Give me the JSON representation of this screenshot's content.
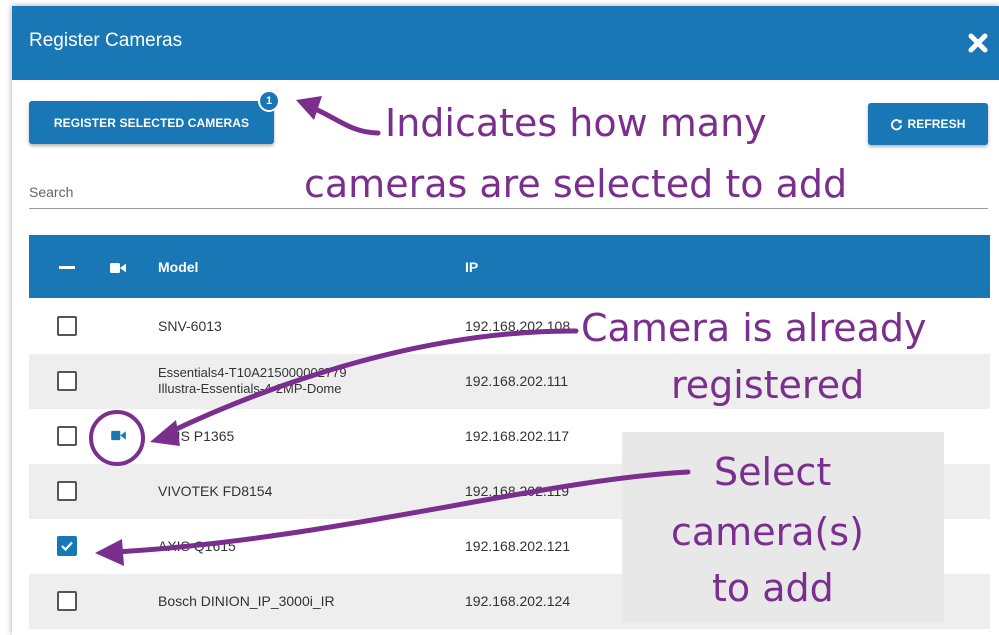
{
  "dialog": {
    "title": "Register Cameras",
    "close_icon": "close-icon",
    "accent_color": "#1877b4"
  },
  "toolbar": {
    "register_label": "REGISTER SELECTED CAMERAS",
    "selected_count": "1",
    "refresh_label": "REFRESH",
    "refresh_icon": "refresh-icon"
  },
  "search": {
    "label": "Search"
  },
  "table": {
    "columns": {
      "select_all_icon": "minus-icon",
      "camera_icon": "video-camera-icon",
      "model": "Model",
      "ip": "IP"
    },
    "rows": [
      {
        "checked": false,
        "registered": false,
        "model": "SNV-6013",
        "model_line2": "",
        "ip": "192.168.202.108"
      },
      {
        "checked": false,
        "registered": false,
        "model": "Essentials4-T10A215000002779",
        "model_line2": "Illustra-Essentials-4-2MP-Dome",
        "ip": "192.168.202.111"
      },
      {
        "checked": false,
        "registered": true,
        "model": "AXIS P1365",
        "model_line2": "",
        "ip": "192.168.202.117"
      },
      {
        "checked": false,
        "registered": false,
        "model": "VIVOTEK FD8154",
        "model_line2": "",
        "ip": "192.168.202.119"
      },
      {
        "checked": true,
        "registered": false,
        "model": "AXIS Q1615",
        "model_line2": "",
        "ip": "192.168.202.121"
      },
      {
        "checked": false,
        "registered": false,
        "model": "Bosch DINION_IP_3000i_IR",
        "model_line2": "",
        "ip": "192.168.202.124"
      }
    ]
  },
  "annotations": {
    "badge_note_line1": "Indicates how many",
    "badge_note_line2": "cameras are selected to add",
    "registered_note_line1": "Camera is already",
    "registered_note_line2": "registered",
    "select_note_line1": "Select",
    "select_note_line2": "camera(s)",
    "select_note_line3": "to add",
    "annotation_color": "#7a2e8e"
  }
}
